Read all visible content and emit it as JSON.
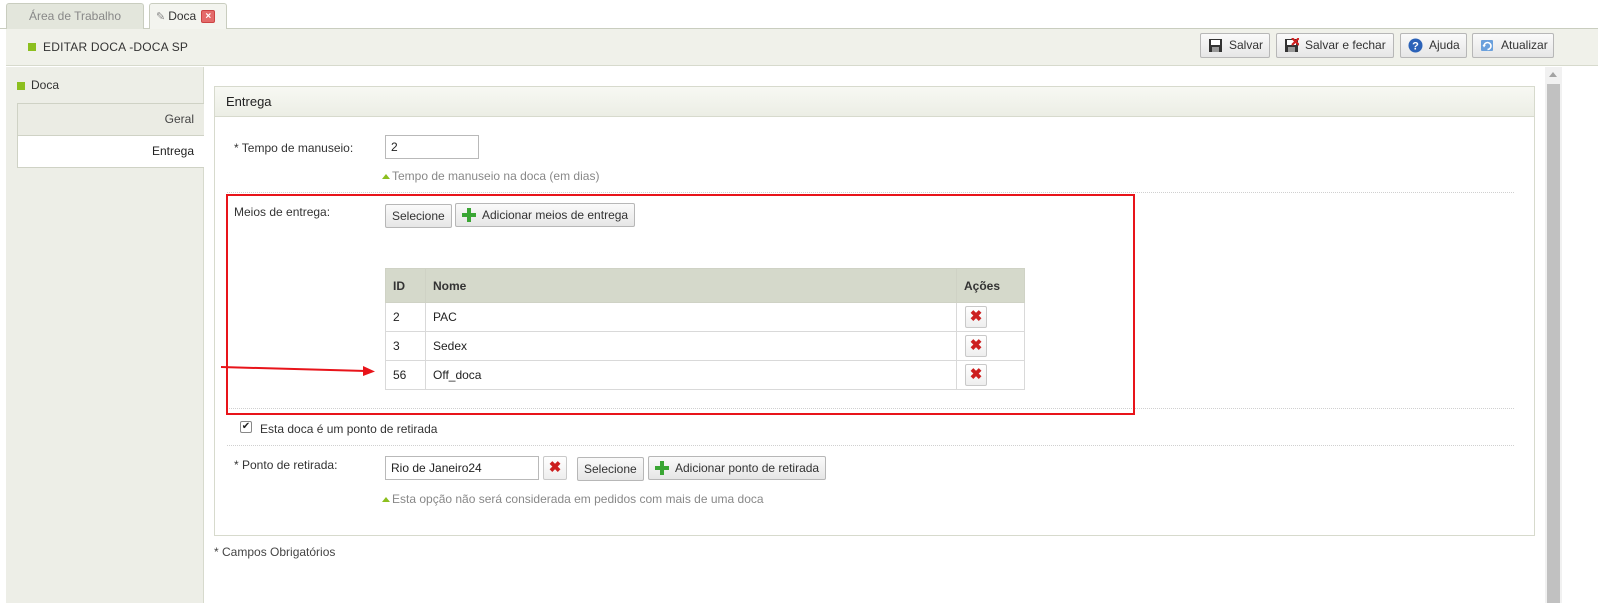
{
  "tabs": [
    {
      "label": "Área de Trabalho",
      "active": false
    },
    {
      "label": "Doca",
      "active": true
    }
  ],
  "header": {
    "title": "EDITAR DOCA -DOCA SP"
  },
  "toolbar": {
    "save": "Salvar",
    "save_close": "Salvar e fechar",
    "help": "Ajuda",
    "refresh": "Atualizar"
  },
  "sidebar": {
    "title": "Doca",
    "items": [
      {
        "label": "Geral",
        "selected": false
      },
      {
        "label": "Entrega",
        "selected": true
      }
    ]
  },
  "panel": {
    "title": "Entrega",
    "handling_time": {
      "label": "* Tempo de manuseio:",
      "value": "2",
      "hint": "Tempo de manuseio na doca (em dias)"
    },
    "delivery_methods": {
      "label": "Meios de entrega:",
      "select_button": "Selecione",
      "add_button": "Adicionar meios de entrega",
      "columns": [
        "ID",
        "Nome",
        "Ações"
      ],
      "rows": [
        {
          "id": "2",
          "name": "PAC"
        },
        {
          "id": "3",
          "name": "Sedex"
        },
        {
          "id": "56",
          "name": "Off_doca"
        }
      ]
    },
    "pickup_checkbox": {
      "label": "Esta doca é um ponto de retirada",
      "checked": true
    },
    "pickup_point": {
      "label": "* Ponto de retirada:",
      "value": "Rio de Janeiro24",
      "select_button": "Selecione",
      "add_button": "Adicionar ponto de retirada",
      "hint": "Esta opção não será considerada em pedidos com mais de uma doca"
    }
  },
  "footnote": "* Campos Obrigatórios",
  "colors": {
    "accent": "#8cbf1f",
    "annotation": "#e8141a",
    "delete": "#cc1f1f",
    "add": "#3aa634"
  }
}
